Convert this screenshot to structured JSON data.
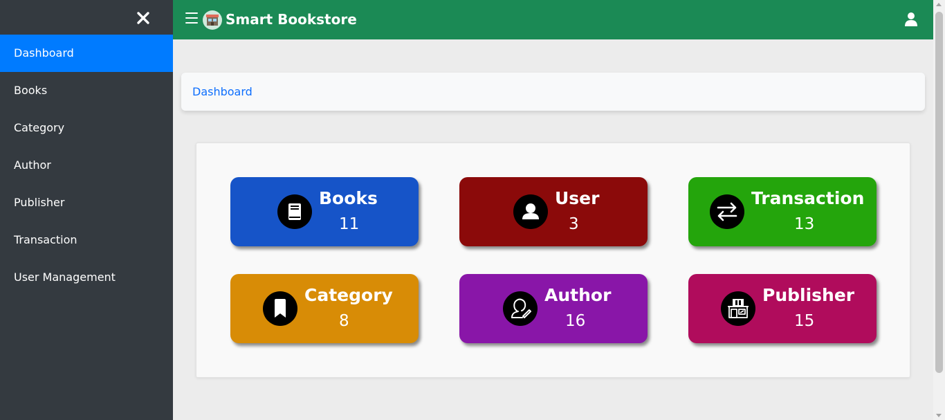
{
  "app": {
    "title": "Smart Bookstore"
  },
  "sidebar": {
    "items": [
      {
        "label": "Dashboard",
        "active": true
      },
      {
        "label": "Books"
      },
      {
        "label": "Category"
      },
      {
        "label": "Author"
      },
      {
        "label": "Publisher"
      },
      {
        "label": "Transaction"
      },
      {
        "label": "User Management"
      }
    ]
  },
  "breadcrumb": {
    "current": "Dashboard"
  },
  "stats": [
    {
      "title": "Books",
      "count": "11",
      "color": "#1654c8",
      "icon": "book-icon"
    },
    {
      "title": "User",
      "count": "3",
      "color": "#8b0a0a",
      "icon": "user-icon"
    },
    {
      "title": "Transaction",
      "count": "13",
      "color": "#24a50c",
      "icon": "exchange-icon"
    },
    {
      "title": "Category",
      "count": "8",
      "color": "#d88c06",
      "icon": "bookmark-icon"
    },
    {
      "title": "Author",
      "count": "16",
      "color": "#8916a8",
      "icon": "author-icon"
    },
    {
      "title": "Publisher",
      "count": "15",
      "color": "#b00c5c",
      "icon": "publisher-icon"
    }
  ],
  "colors": {
    "sidebar": "#343a40",
    "active": "#007bff",
    "header": "#1b8a55"
  }
}
